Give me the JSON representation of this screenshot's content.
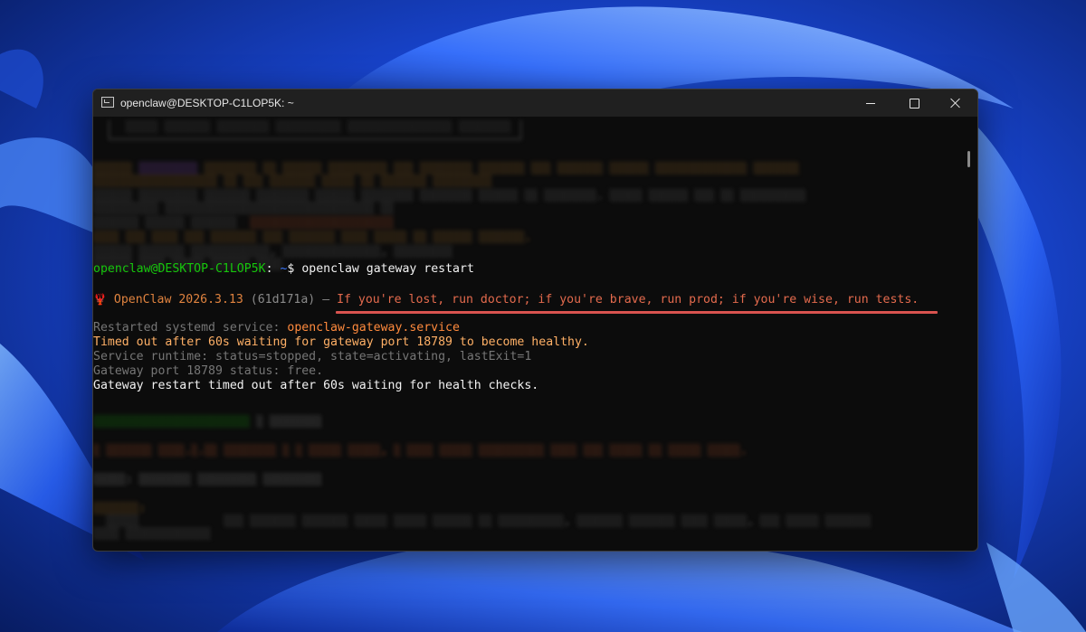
{
  "window": {
    "title": "openclaw@DESKTOP-C1LOP5K: ~"
  },
  "terminal": {
    "prompt": {
      "user_host": "openclaw@DESKTOP-C1LOP5K",
      "path": "~",
      "symbol": "$",
      "command": "openclaw gateway restart"
    },
    "banner": {
      "icon": "🦞",
      "name": "OpenClaw 2026.3.13",
      "commit": "(61d171a)",
      "dash": "—",
      "tagline": "If you're lost, run doctor; if you're brave, run prod; if you're wise, run tests."
    },
    "output": {
      "restarted_label": "Restarted systemd service: ",
      "service_name": "openclaw-gateway.service",
      "timeout_line": "Timed out after 60s waiting for gateway port 18789 to become healthy.",
      "runtime_line": "Service runtime: status=stopped, state=activating, lastExit=1",
      "port_line": "Gateway port 18789 status: free.",
      "final_line": "Gateway restart timed out after 60s waiting for health checks."
    }
  },
  "colors": {
    "prompt_user": "#16c60c",
    "prompt_path": "#3b78ff",
    "tagline": "#e36a4d",
    "highlight_underline": "#d9534f",
    "window_bg": "#0c0c0c",
    "titlebar_bg": "#202020"
  },
  "icons": {
    "app": "terminal-icon",
    "minimize": "minimize-icon",
    "maximize": "maximize-icon",
    "close": "close-icon"
  }
}
